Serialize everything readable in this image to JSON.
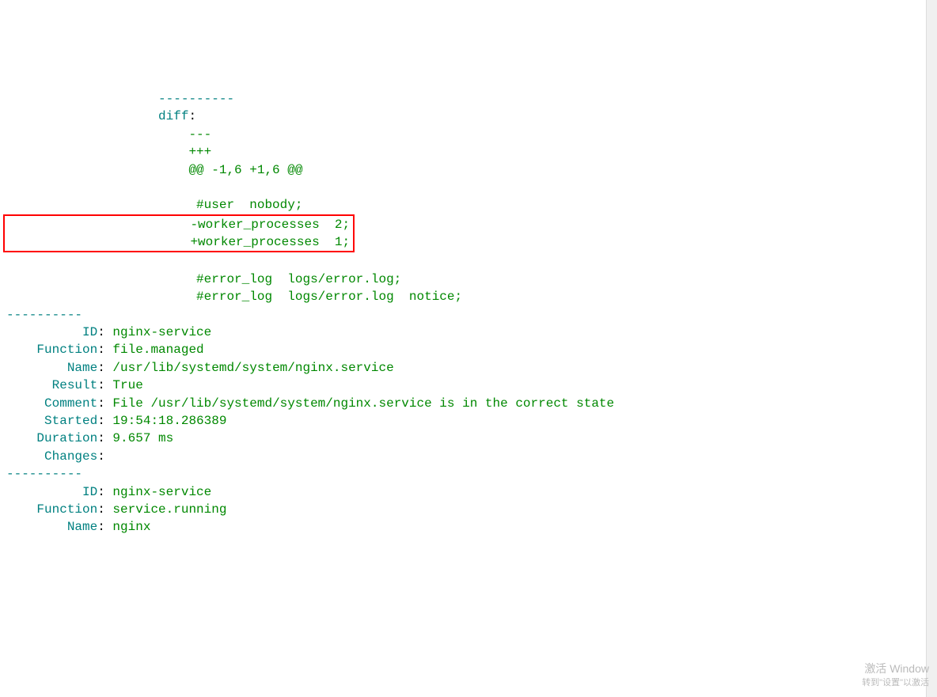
{
  "lines": {
    "dashes1": "                    ----------",
    "diff_key": "                    diff",
    "diff_colon": ":",
    "diff_sub1": "                        ---",
    "diff_sub2": "                        +++",
    "diff_hunk": "                        @@ -1,6 +1,6 @@",
    "blank1": " ",
    "user_nobody": "                         #user  nobody;",
    "worker_minus": "                        -worker_processes  2;",
    "worker_plus": "                        +worker_processes  1;",
    "blank2": " ",
    "errorlog1": "                         #error_log  logs/error.log;",
    "errorlog2": "                         #error_log  logs/error.log  notice;",
    "sep1": "----------",
    "id1_key": "          ID",
    "id1_val": " nginx-service",
    "func1_key": "    Function",
    "func1_val": " file.managed",
    "name1_key": "        Name",
    "name1_val": " /usr/lib/systemd/system/nginx.service",
    "result1_key": "      Result",
    "result1_val": " True",
    "comment1_key": "     Comment",
    "comment1_val": " File /usr/lib/systemd/system/nginx.service is in the correct state",
    "started1_key": "     Started",
    "started1_val": " 19:54:18.286389",
    "duration1_key": "    Duration",
    "duration1_val": " 9.657 ms",
    "changes1_key": "     Changes",
    "changes1_val": "",
    "sep2": "----------",
    "id2_key": "          ID",
    "id2_val": " nginx-service",
    "func2_key": "    Function",
    "func2_val": " service.running",
    "name2_key": "        Name",
    "name2_val": " nginx"
  },
  "watermark": {
    "line1": "激活 Window",
    "line2": "转到\"设置\"以激活"
  }
}
